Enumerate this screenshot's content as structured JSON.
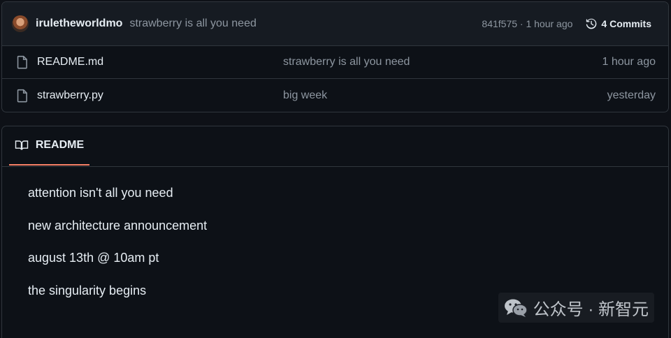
{
  "commit": {
    "author": "iruletheworldmo",
    "message": "strawberry is all you need",
    "meta": "841f575 · 1 hour ago",
    "commits_label": "4 Commits"
  },
  "files": [
    {
      "name": "README.md",
      "message": "strawberry is all you need",
      "time": "1 hour ago",
      "icon": "file-icon"
    },
    {
      "name": "strawberry.py",
      "message": "big week",
      "time": "yesterday",
      "icon": "file-icon"
    }
  ],
  "readme": {
    "tab_label": "README",
    "lines": [
      "attention isn't all you need",
      "new architecture announcement",
      "august 13th @ 10am pt",
      "the singularity begins"
    ]
  },
  "watermark": {
    "text": "公众号 · 新智元"
  },
  "colors": {
    "background": "#0d1117",
    "border": "#30363d",
    "muted_text": "#8d96a0",
    "tab_underline": "#f78166"
  }
}
